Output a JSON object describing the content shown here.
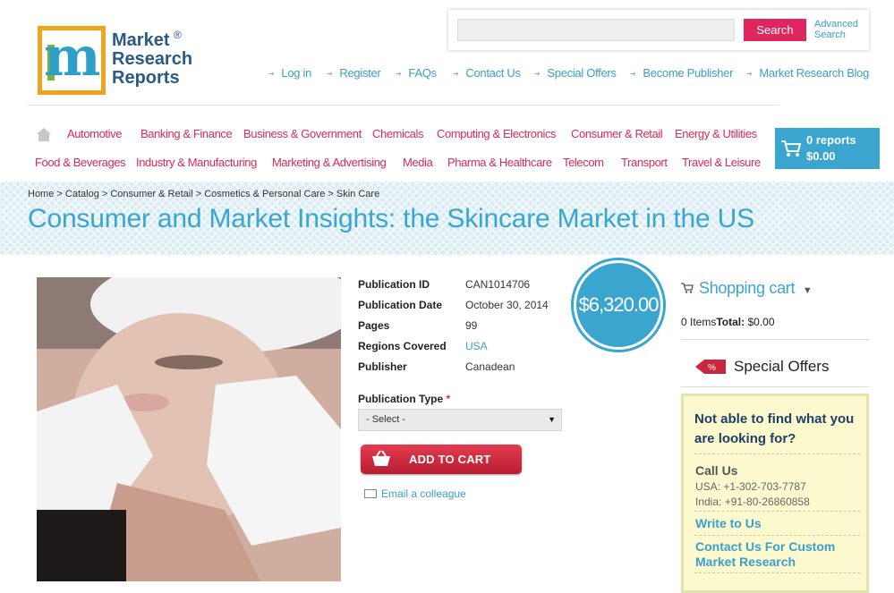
{
  "logo": {
    "line1": "Market",
    "line2": "Research",
    "line3": "Reports",
    "reg": "®",
    "mark": "m"
  },
  "search": {
    "placeholder": "",
    "button": "Search",
    "advanced": "Advanced Search"
  },
  "top_links": [
    {
      "label": "Log in"
    },
    {
      "label": "Register"
    },
    {
      "label": "FAQs"
    },
    {
      "label": "Contact Us"
    },
    {
      "label": "Special Offers"
    },
    {
      "label": "Become Publisher"
    },
    {
      "label": "Market Research Blog"
    }
  ],
  "categories_row1": [
    "Automotive",
    "Banking & Finance",
    "Business & Government",
    "Chemicals",
    "Computing & Electronics",
    "Consumer & Retail",
    "Energy & Utilities"
  ],
  "categories_row2": [
    "Food & Beverages",
    "Industry & Manufacturing",
    "Marketing & Advertising",
    "Media",
    "Pharma & Healthcare",
    "Telecom",
    "Transport",
    "Travel & Leisure"
  ],
  "cart_button": {
    "reports": "0 reports",
    "total": "$0.00"
  },
  "breadcrumb": [
    "Home",
    "Catalog",
    "Consumer & Retail",
    "Cosmetics & Personal Care",
    "Skin Care"
  ],
  "title": "Consumer and Market Insights: the Skincare Market in the US",
  "details": {
    "publication_id_label": "Publication ID",
    "publication_id": "CAN1014706",
    "publication_date_label": "Publication Date",
    "publication_date": "October 30, 2014",
    "pages_label": "Pages",
    "pages": "99",
    "regions_label": "Regions Covered",
    "regions": "USA",
    "publisher_label": "Publisher",
    "publisher": "Canadean"
  },
  "price": "$6,320.00",
  "publication_type": {
    "label": "Publication Type",
    "required": "*",
    "selected": "- Select -"
  },
  "add_to_cart": "ADD TO CART",
  "email_colleague": "Email a colleague",
  "sidebar": {
    "cart_title": "Shopping cart",
    "cart_items": "0 Items",
    "cart_total_label": "Total:",
    "cart_total": "$0.00",
    "special_offers": "Special Offers",
    "help": {
      "question": "Not able to find what you are looking for?",
      "call_us": "Call Us",
      "usa": "USA: +1-302-703-7787",
      "india": "India: +91-80-26860858",
      "write": "Write to Us",
      "custom": "Contact Us For Custom Market Research"
    }
  },
  "colors": {
    "accent_blue": "#3aa6cf",
    "accent_pink": "#d8285f",
    "button_red": "#c8283d",
    "help_bg": "#fdf9cf"
  }
}
